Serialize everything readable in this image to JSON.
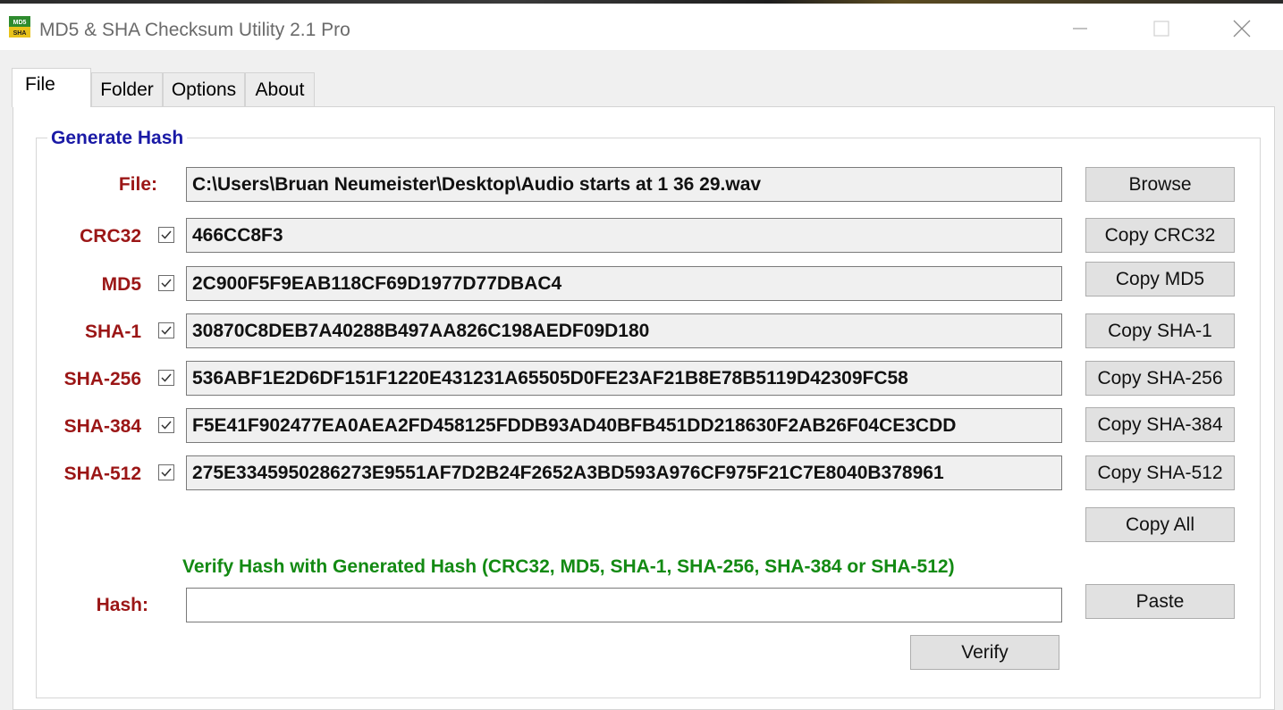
{
  "window": {
    "title": "MD5 & SHA Checksum Utility 2.1 Pro",
    "icon_label_top": "MD5",
    "icon_label_bottom": "SHA",
    "controls": [
      "minimize-icon",
      "maximize-icon",
      "close-icon"
    ]
  },
  "tabs": [
    {
      "label": "File",
      "selected": true
    },
    {
      "label": "Folder",
      "selected": false
    },
    {
      "label": "Options",
      "selected": false
    },
    {
      "label": "About",
      "selected": false
    }
  ],
  "group": {
    "title": "Generate Hash"
  },
  "file": {
    "label": "File:",
    "value": "C:\\Users\\Bruan Neumeister\\Desktop\\Audio starts at 1 36 29.wav",
    "button": "Browse"
  },
  "hashes": [
    {
      "label": "CRC32",
      "checked": true,
      "value": "466CC8F3",
      "button": "Copy CRC32"
    },
    {
      "label": "MD5",
      "checked": true,
      "value": "2C900F5F9EAB118CF69D1977D77DBAC4",
      "button": "Copy MD5"
    },
    {
      "label": "SHA-1",
      "checked": true,
      "value": "30870C8DEB7A40288B497AA826C198AEDF09D180",
      "button": "Copy SHA-1"
    },
    {
      "label": "SHA-256",
      "checked": true,
      "value": "536ABF1E2D6DF151F1220E431231A65505D0FE23AF21B8E78B5119D42309FC58",
      "button": "Copy SHA-256"
    },
    {
      "label": "SHA-384",
      "checked": true,
      "value": "F5E41F902477EA0AEA2FD458125FDDB93AD40BFB451DD218630F2AB26F04CE3CDD",
      "button": "Copy SHA-384"
    },
    {
      "label": "SHA-512",
      "checked": true,
      "value": "275E3345950286273E9551AF7D2B24F2652A3BD593A976CF975F21C7E8040B378961",
      "button": "Copy SHA-512"
    }
  ],
  "copy_all": "Copy All",
  "verify": {
    "note": "Verify Hash with Generated Hash (CRC32, MD5, SHA-1, SHA-256, SHA-384 or SHA-512)",
    "hash_label": "Hash:",
    "hash_value": "",
    "paste_button": "Paste",
    "verify_button": "Verify"
  },
  "colors": {
    "label_red": "#9b1616",
    "group_title_blue": "#1a1aa6",
    "verify_note_green": "#138a13"
  }
}
